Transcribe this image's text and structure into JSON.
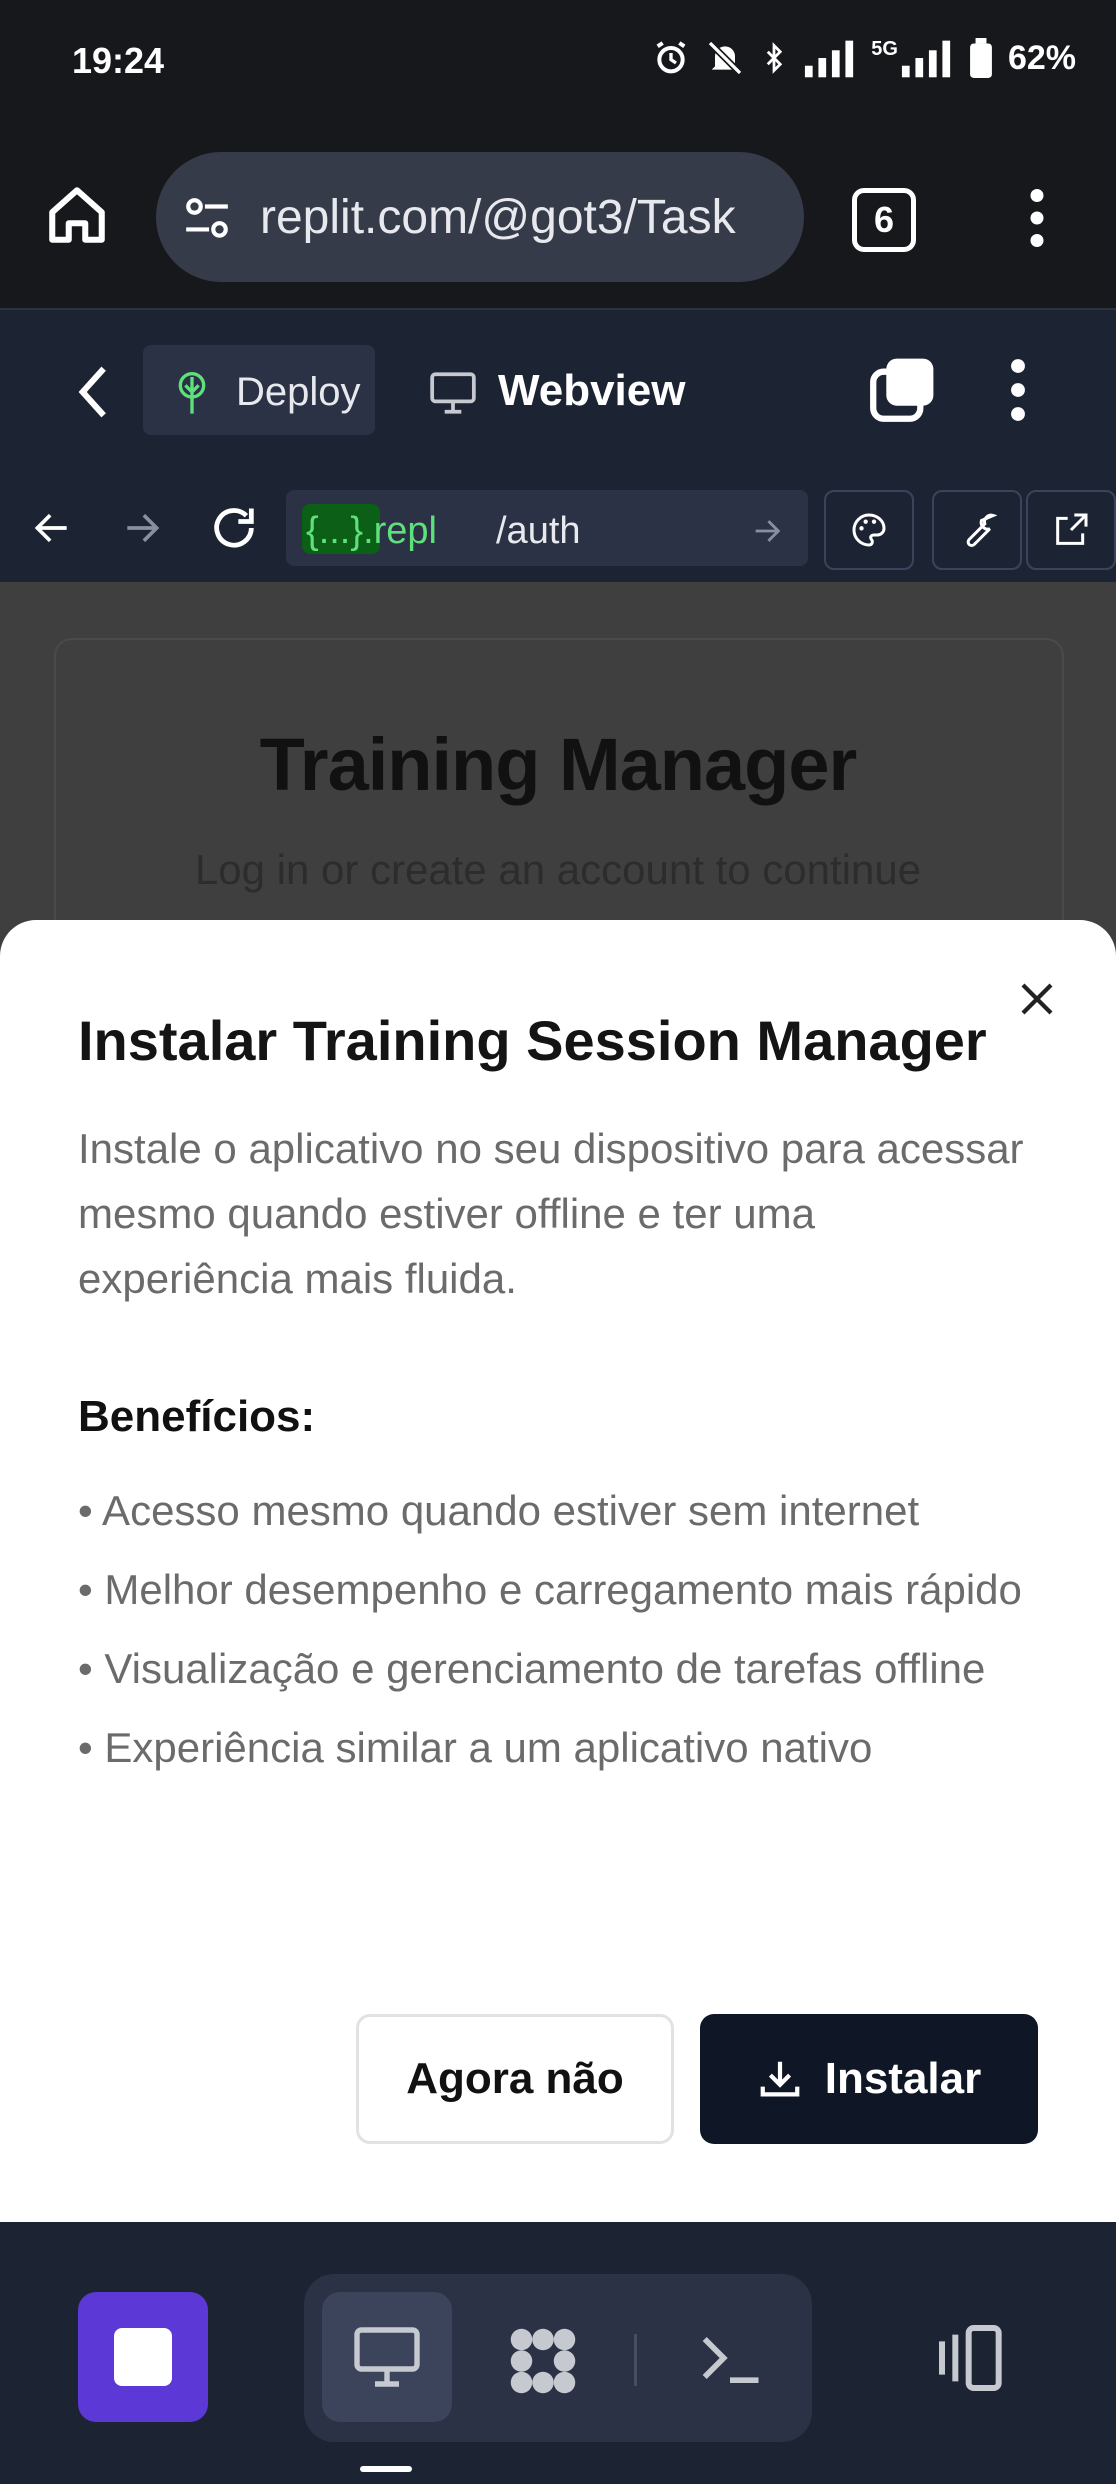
{
  "status_bar": {
    "time": "19:24",
    "network": "5G",
    "battery": "62%",
    "icons": [
      "alarm-icon",
      "bell-off-icon",
      "bluetooth-icon",
      "signal-icon",
      "signal-5g-icon",
      "battery-icon"
    ]
  },
  "browser": {
    "url": "replit.com/@got3/Task",
    "tab_count": "6"
  },
  "replit_header": {
    "deploy_label": "Deploy",
    "webview_label": "Webview"
  },
  "webview_nav": {
    "url_badge": "{...}",
    "url_domain": ".repl",
    "url_path": "/auth"
  },
  "app": {
    "title": "Training Manager",
    "subtitle": "Log in or create an account to continue"
  },
  "dialog": {
    "title": "Instalar Training Session Manager",
    "description": "Instale o aplicativo no seu dispositivo para acessar mesmo quando estiver offline e ter uma experiência mais fluida.",
    "benefits_heading": "Benefícios:",
    "benefits": [
      "• Acesso mesmo quando estiver sem internet",
      "• Melhor desempenho e carregamento mais rápido",
      "• Visualização e gerenciamento de tarefas offline",
      "• Experiência similar a um aplicativo nativo"
    ],
    "cancel_label": "Agora não",
    "install_label": "Instalar"
  },
  "colors": {
    "accent_purple": "#5c38d6",
    "dark_bg": "#1c2333",
    "install_btn": "#0f1626",
    "repl_green": "#5ee07b"
  }
}
